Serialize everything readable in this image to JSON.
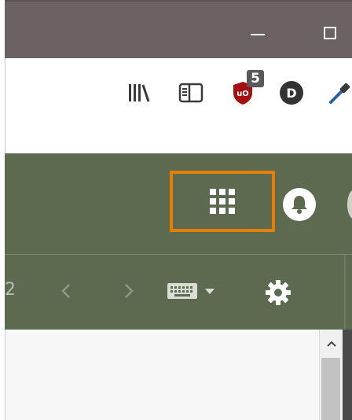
{
  "window": {
    "minimize_icon": "minimize-icon",
    "maximize_icon": "maximize-icon"
  },
  "toolbar": {
    "library_icon": "library-icon",
    "reader_icon": "reader-view-icon",
    "ublock_icon": "ublock-origin-icon",
    "ublock_badge": "5",
    "account_letter": "D",
    "eyedropper_icon": "eyedropper-icon"
  },
  "appbar": {
    "apps_icon": "apps-grid-icon",
    "highlight_color": "#e67e00",
    "bell_icon": "bell-icon",
    "background": "#5c6b50"
  },
  "navbar": {
    "page_number": "2",
    "prev_icon": "chevron-left-icon",
    "next_icon": "chevron-right-icon",
    "keyboard_icon": "keyboard-icon",
    "dropdown_icon": "caret-down-icon",
    "settings_icon": "gear-icon"
  },
  "scrollbar": {
    "up_icon": "chevron-up-icon"
  }
}
